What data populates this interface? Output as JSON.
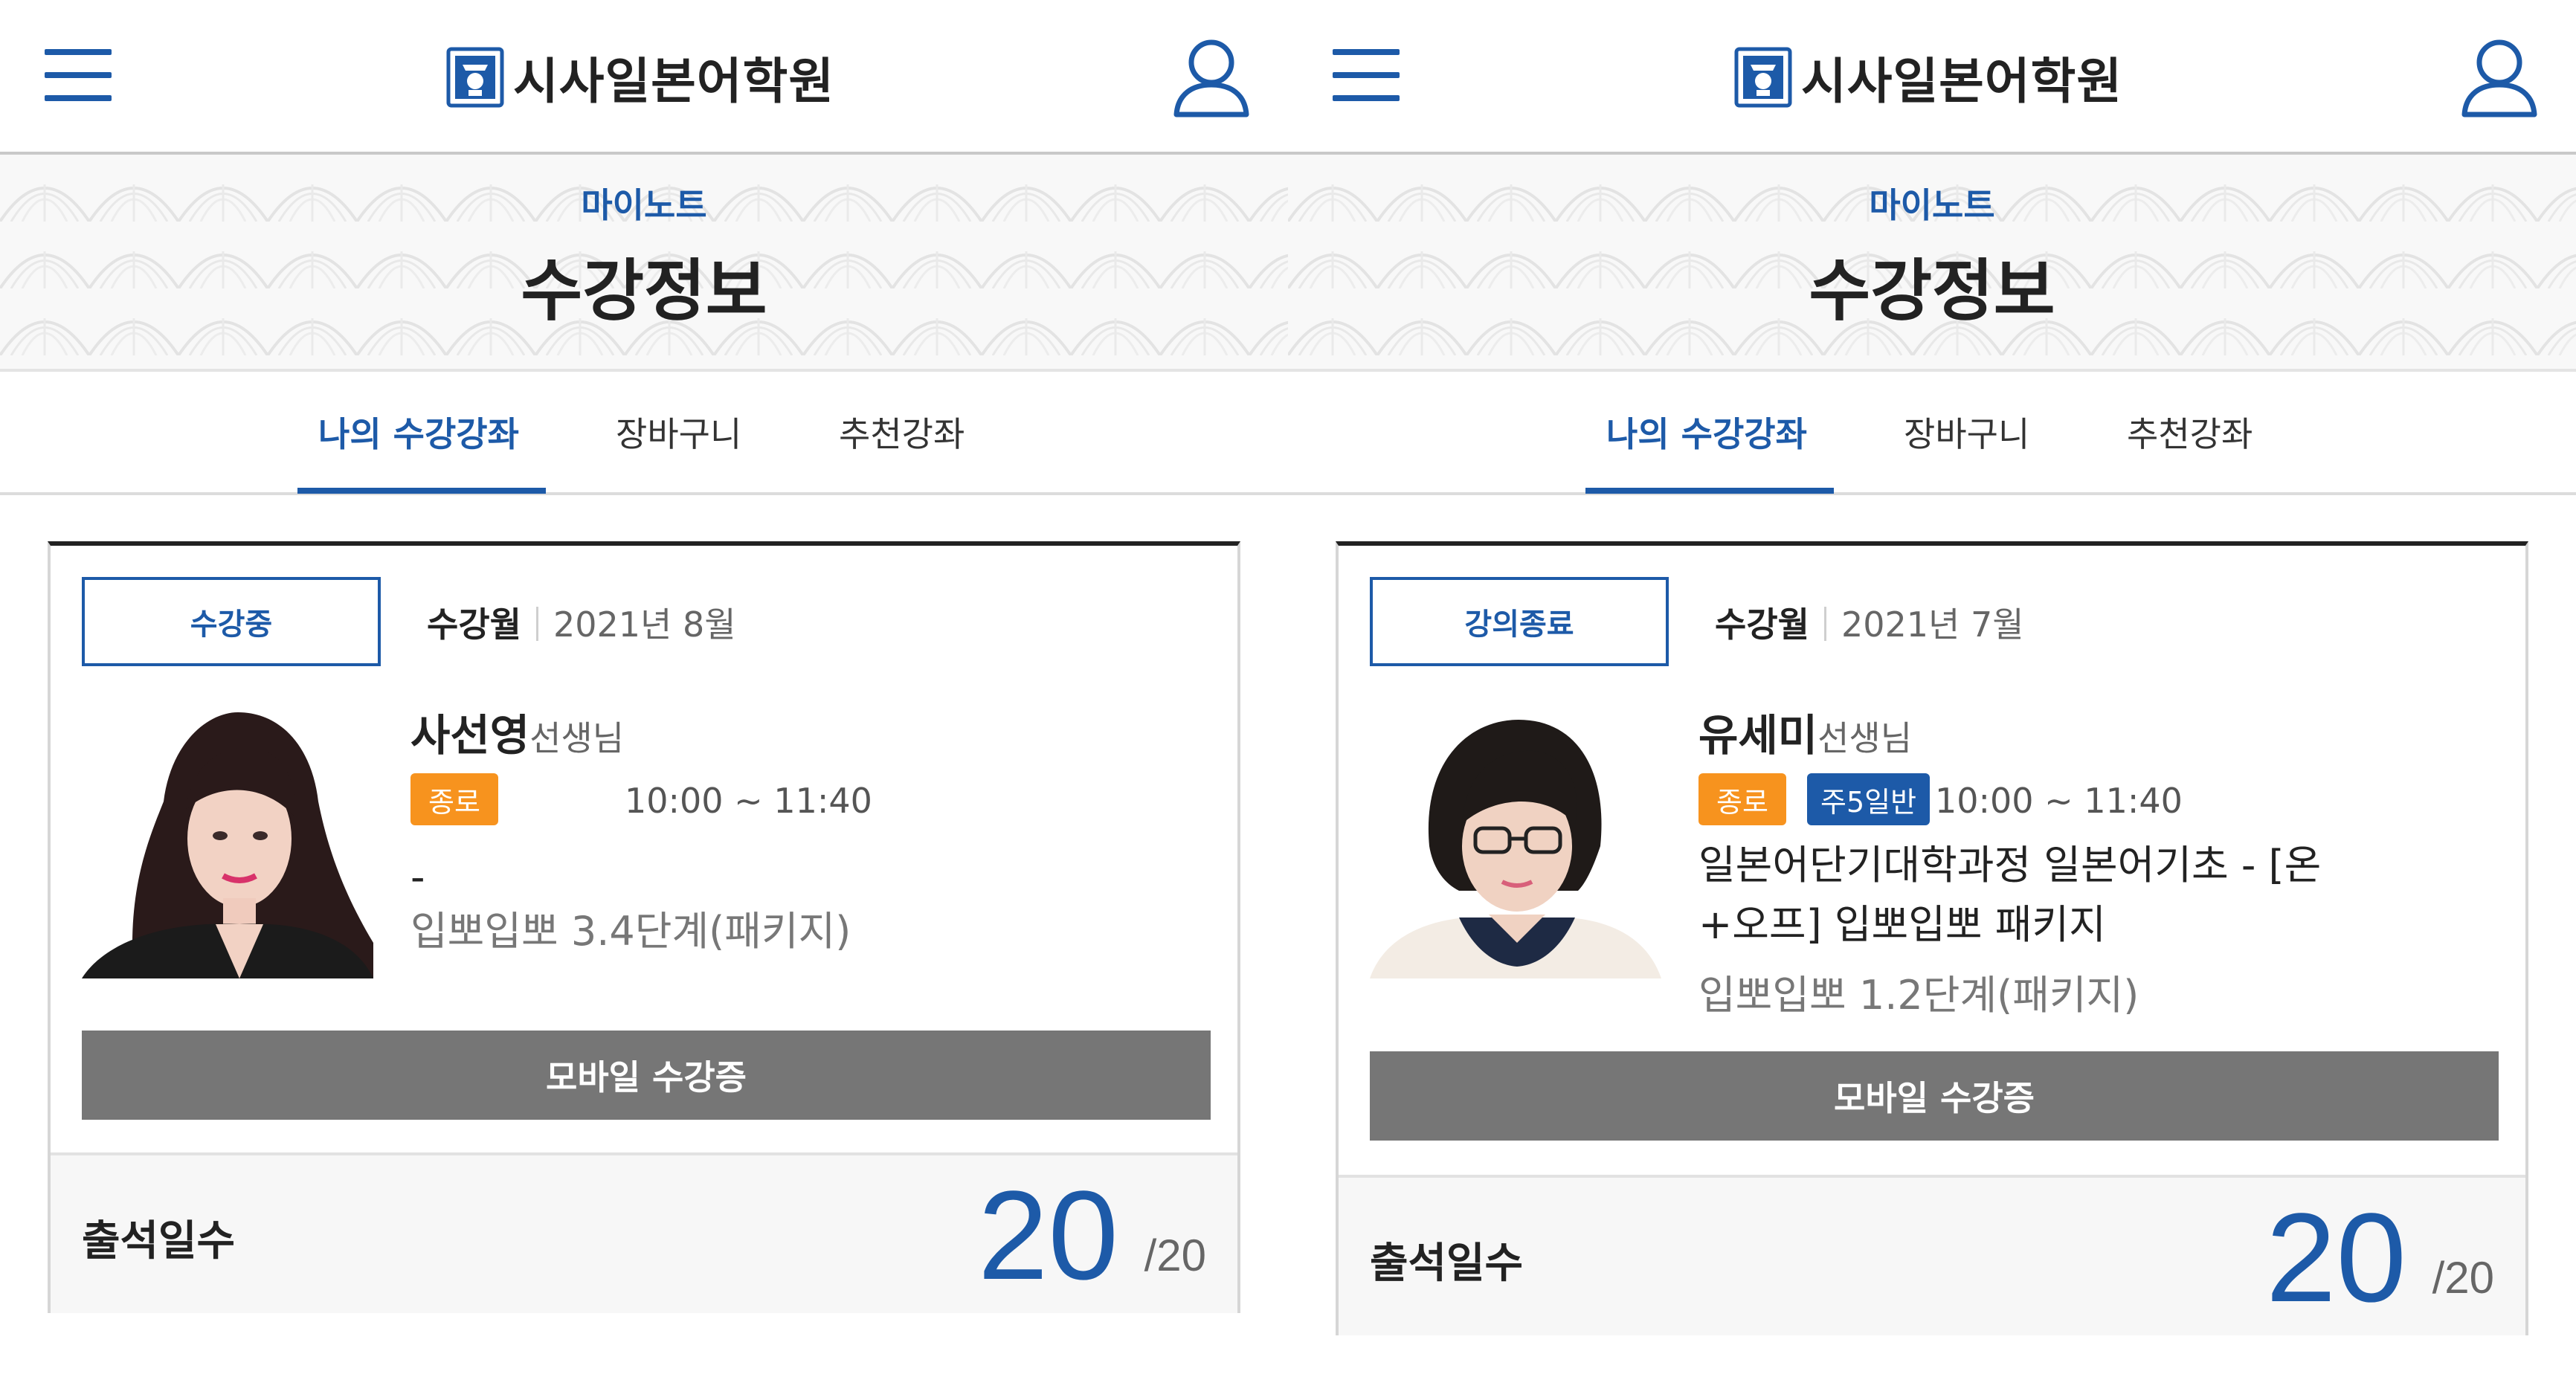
{
  "panels": [
    {
      "header": {
        "logo_text": "시사일본어학원"
      },
      "banner": {
        "subtitle": "마이노트",
        "title": "수강정보"
      },
      "tabs": [
        {
          "label": "나의 수강강좌",
          "active": true
        },
        {
          "label": "장바구니"
        },
        {
          "label": "추천강좌"
        }
      ],
      "course": {
        "status": "수강중",
        "month_label": "수강월",
        "month_value": "2021년 8월",
        "teacher_name": "사선영",
        "teacher_suffix": "선생님",
        "tag_location": "종로",
        "time": "10:00 ~ 11:40",
        "description": "-",
        "package": "입뽀입뽀 3.4단계(패키지)",
        "mobile_button": "모바일 수강증",
        "attendance_label": "출석일수",
        "attendance_value": "20",
        "attendance_total": "/20"
      }
    },
    {
      "header": {
        "logo_text": "시사일본어학원"
      },
      "banner": {
        "subtitle": "마이노트",
        "title": "수강정보"
      },
      "tabs": [
        {
          "label": "나의 수강강좌",
          "active": true
        },
        {
          "label": "장바구니"
        },
        {
          "label": "추천강좌"
        }
      ],
      "course": {
        "status": "강의종료",
        "month_label": "수강월",
        "month_value": "2021년 7월",
        "teacher_name": "유세미",
        "teacher_suffix": "선생님",
        "tag_location": "종로",
        "tag_class": "주5일반",
        "time": "10:00 ~ 11:40",
        "description_line1": "일본어단기대학과정 일본어기초 - [온",
        "description_line2": "+오프] 입뽀입뽀 패키지",
        "package": "입뽀입뽀 1.2단계(패키지)",
        "mobile_button": "모바일 수강증",
        "attendance_label": "출석일수",
        "attendance_value": "20",
        "attendance_total": "/20"
      }
    }
  ],
  "colors": {
    "accent": "#1d5aa8",
    "tag_orange": "#f7931e",
    "button_gray": "#767676"
  },
  "icons": {
    "menu": "hamburger-icon",
    "user": "user-icon",
    "logo": "logo-emblem-icon"
  }
}
